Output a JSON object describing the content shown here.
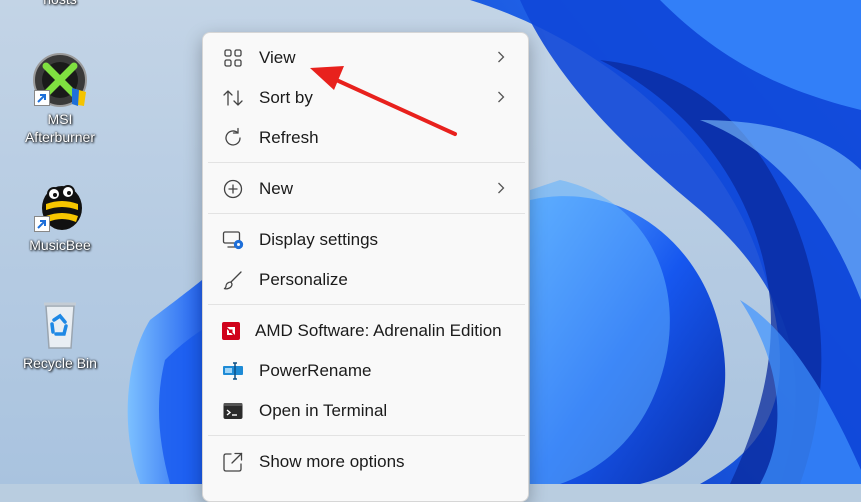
{
  "desktop": {
    "icons": [
      {
        "label": "hosts"
      },
      {
        "label": "MSI Afterburner"
      },
      {
        "label": "MusicBee"
      },
      {
        "label": "Recycle Bin"
      }
    ]
  },
  "context_menu": {
    "items": [
      {
        "label": "View",
        "icon": "grid-icon",
        "submenu": true
      },
      {
        "label": "Sort by",
        "icon": "sort-arrows-icon",
        "submenu": true
      },
      {
        "label": "Refresh",
        "icon": "refresh-icon",
        "submenu": false
      },
      {
        "label": "New",
        "icon": "plus-circle-icon",
        "submenu": true
      },
      {
        "label": "Display settings",
        "icon": "monitor-gear-icon",
        "submenu": false
      },
      {
        "label": "Personalize",
        "icon": "brush-icon",
        "submenu": false
      },
      {
        "label": "AMD Software: Adrenalin Edition",
        "icon": "amd-logo-icon",
        "submenu": false
      },
      {
        "label": "PowerRename",
        "icon": "powerrename-icon",
        "submenu": false
      },
      {
        "label": "Open in Terminal",
        "icon": "terminal-icon",
        "submenu": false
      },
      {
        "label": "Show more options",
        "icon": "expand-icon",
        "submenu": false
      }
    ]
  },
  "colors": {
    "annotation_arrow": "#e8211d",
    "wallpaper_blue": "#1a5cf0",
    "amd_red": "#d0021b",
    "powerrename_blue": "#1e8bd6"
  }
}
